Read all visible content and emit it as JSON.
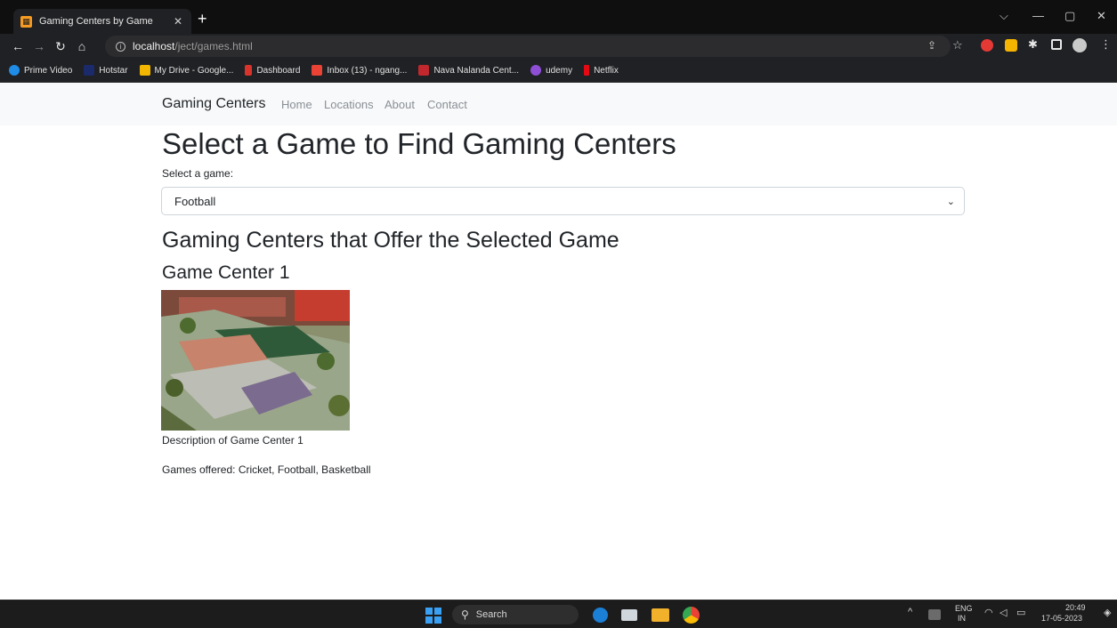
{
  "browser": {
    "tab_title": "Gaming Centers by Game",
    "url_host": "localhost",
    "url_path": "/ject/games.html",
    "bookmarks": [
      {
        "label": "Prime Video",
        "color": "#1f8ce6"
      },
      {
        "label": "Hotstar",
        "color": "#1b2a6b"
      },
      {
        "label": "My Drive - Google...",
        "color": "#f2b600"
      },
      {
        "label": "Dashboard",
        "color": "#d9342b"
      },
      {
        "label": "Inbox (13) - ngang...",
        "color": "#ea4335"
      },
      {
        "label": "Nava Nalanda Cent...",
        "color": "#c0282d"
      },
      {
        "label": "udemy",
        "color": "#8e4fd6"
      },
      {
        "label": "Netflix",
        "color": "#e50914"
      }
    ]
  },
  "navbar": {
    "brand": "Gaming Centers",
    "links": [
      "Home",
      "Locations",
      "About",
      "Contact"
    ]
  },
  "main": {
    "heading": "Select a Game to Find Gaming Centers",
    "select_label": "Select a game:",
    "selected_game": "Football",
    "results_heading": "Gaming Centers that Offer the Selected Game",
    "centers": [
      {
        "name": "Game Center 1",
        "description": "Description of Game Center 1",
        "games": "Games offered: Cricket, Football, Basketball"
      }
    ]
  },
  "taskbar": {
    "search_label": "Search",
    "lang_top": "ENG",
    "lang_bottom": "IN",
    "time": "20:49",
    "date": "17-05-2023"
  }
}
